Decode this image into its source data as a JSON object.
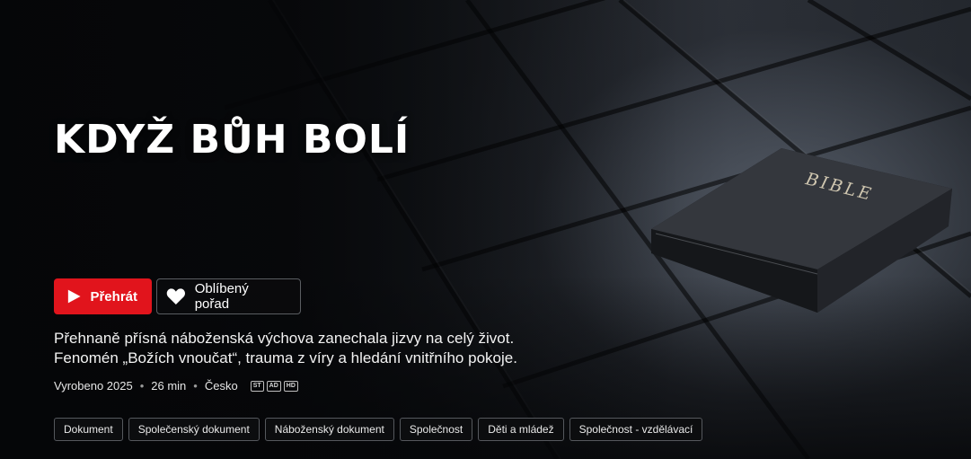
{
  "show": {
    "title": "KDYŽ BŮH BOLÍ",
    "description_line1": "Přehnaně přísná náboženská výchova zanechala jizvy na celý život.",
    "description_line2": "Fenomén „Božích vnoučat“, trauma z víry a hledání vnitřního pokoje.",
    "book_label": "BIBLE"
  },
  "actions": {
    "play_label": "Přehrát",
    "favorite_label": "Oblíbený pořad"
  },
  "meta": {
    "year": "Vyrobeno 2025",
    "duration": "26 min",
    "country": "Česko",
    "badges": [
      "ST",
      "AD",
      "HD"
    ]
  },
  "tags": [
    "Dokument",
    "Společenský dokument",
    "Náboženský dokument",
    "Společnost",
    "Děti a mládež",
    "Společnost - vzdělávací"
  ],
  "colors": {
    "accent": "#e1141c",
    "background": "#0b0d10"
  }
}
